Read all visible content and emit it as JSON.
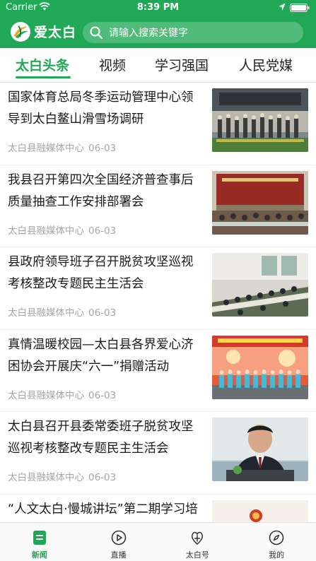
{
  "status_bar": {
    "carrier": "Carrier",
    "time": "8:39 PM"
  },
  "app_bar": {
    "brand": "爱太白",
    "search_placeholder": "请输入搜索关键字"
  },
  "tabs": [
    {
      "label": "太白头条",
      "active": true
    },
    {
      "label": "视频",
      "active": false
    },
    {
      "label": "学习强国",
      "active": false
    },
    {
      "label": "人民党媒",
      "active": false
    }
  ],
  "news": [
    {
      "title": "国家体育总局冬季运动管理中心领导到太白鳌山滑雪场调研",
      "source": "太白县融媒体中心",
      "date": "06-03"
    },
    {
      "title": "我县召开第四次全国经济普查事后质量抽查工作安排部署会",
      "source": "太白县融媒体中心",
      "date": "06-03"
    },
    {
      "title": "县政府领导班子召开脱贫攻坚巡视考核整改专题民主生活会",
      "source": "太白县融媒体中心",
      "date": "06-03"
    },
    {
      "title": "真情温暖校园—太白县各界爱心济困协会开展庆“六一”捐赠活动",
      "source": "太白县融媒体中心",
      "date": "06-03"
    },
    {
      "title": "太白县召开县委常委班子脱贫攻坚巡视考核整改专题民主生活会",
      "source": "太白县融媒体中心",
      "date": "06-03"
    },
    {
      "title": "“人文太白·慢城讲坛”第二期学习培训讲座开讲",
      "source": "",
      "date": ""
    }
  ],
  "bottom_tabs": [
    {
      "label": "新闻",
      "icon": "news-icon",
      "active": true
    },
    {
      "label": "直播",
      "icon": "play-icon",
      "active": false
    },
    {
      "label": "太白号",
      "icon": "taibai-hao-icon",
      "active": false
    },
    {
      "label": "我的",
      "icon": "compass-icon",
      "active": false
    }
  ],
  "colors": {
    "brand_green": "#1fa855",
    "meta_gray": "#a6a6a6"
  }
}
